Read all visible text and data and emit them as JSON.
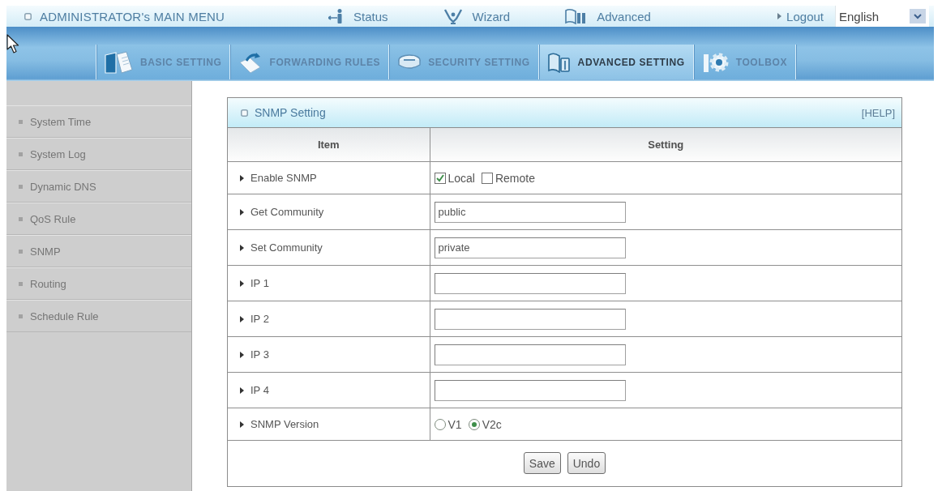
{
  "top_menu": {
    "title": "ADMINISTRATOR's MAIN MENU",
    "links": [
      {
        "kind": "status",
        "label": "Status"
      },
      {
        "kind": "wizard",
        "label": "Wizard"
      },
      {
        "kind": "advanced",
        "label": "Advanced"
      }
    ],
    "logout": "Logout",
    "language": {
      "value": "English"
    }
  },
  "nav_tabs": [
    {
      "kind": "basic",
      "label": "BASIC SETTING",
      "selected": false
    },
    {
      "kind": "forwarding",
      "label": "FORWARDING RULES",
      "selected": false
    },
    {
      "kind": "security",
      "label": "SECURITY SETTING",
      "selected": false
    },
    {
      "kind": "advanced",
      "label": "ADVANCED SETTING",
      "selected": true
    },
    {
      "kind": "toolbox",
      "label": "TOOLBOX",
      "selected": false
    }
  ],
  "sidebar": {
    "items": [
      "System Time",
      "System Log",
      "Dynamic DNS",
      "QoS Rule",
      "SNMP",
      "Routing",
      "Schedule Rule"
    ]
  },
  "panel": {
    "title": "SNMP Setting",
    "help": "[HELP]",
    "columns": [
      "Item",
      "Setting"
    ],
    "rows": [
      {
        "kind": "checkboxes",
        "label": "Enable SNMP",
        "options": [
          {
            "label": "Local",
            "checked": true
          },
          {
            "label": "Remote",
            "checked": false
          }
        ]
      },
      {
        "kind": "text",
        "label": "Get Community",
        "value": "public"
      },
      {
        "kind": "text",
        "label": "Set Community",
        "value": "private"
      },
      {
        "kind": "text",
        "label": "IP 1"
      },
      {
        "kind": "text",
        "label": "IP 2"
      },
      {
        "kind": "text",
        "label": "IP 3"
      },
      {
        "kind": "text",
        "label": "IP 4"
      },
      {
        "kind": "radios",
        "label": "SNMP Version",
        "options": [
          {
            "label": "V1",
            "selected": false
          },
          {
            "label": "V2c",
            "selected": true
          }
        ]
      }
    ],
    "buttons": [
      "Save",
      "Undo"
    ]
  }
}
